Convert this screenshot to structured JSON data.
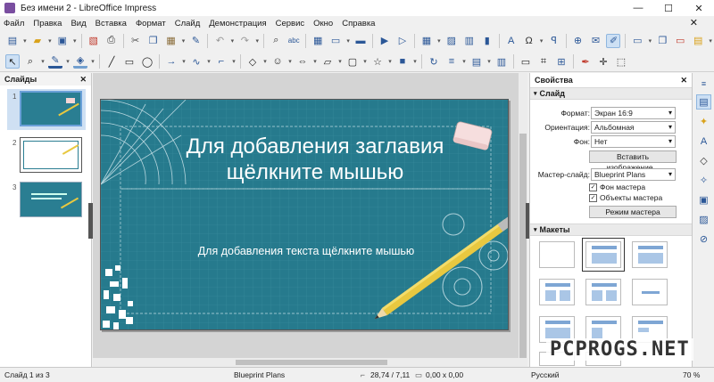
{
  "window": {
    "title": "Без имени 2 - LibreOffice Impress",
    "minimize": "—",
    "maximize": "☐",
    "close": "✕"
  },
  "menu": [
    "Файл",
    "Правка",
    "Вид",
    "Вставка",
    "Формат",
    "Слайд",
    "Демонстрация",
    "Сервис",
    "Окно",
    "Справка"
  ],
  "menu_close": "✕",
  "slides_panel": {
    "title": "Слайды",
    "close": "✕",
    "slides": [
      {
        "num": "1",
        "layout": "blue"
      },
      {
        "num": "2",
        "layout": "white"
      },
      {
        "num": "3",
        "layout": "blue"
      }
    ]
  },
  "slide": {
    "title": "Для добавления заглавия щёлкните мышью",
    "subtitle": "Для добавления текста щёлкните мышью",
    "background": "#267a8d"
  },
  "properties": {
    "title": "Свойства",
    "close": "✕",
    "slide_section": "Слайд",
    "format_label": "Формат:",
    "format_value": "Экран 16:9",
    "orientation_label": "Ориентация:",
    "orientation_value": "Альбомная",
    "background_label": "Фон:",
    "background_value": "Нет",
    "insert_image_button": "Вставить изображение...",
    "master_label": "Мастер-слайд:",
    "master_value": "Blueprint Plans",
    "master_bg_check": "Фон мастера",
    "master_objects_check": "Объекты мастера",
    "master_mode_button": "Режим мастера",
    "layouts_section": "Макеты"
  },
  "statusbar": {
    "slide_info": "Слайд 1 из 3",
    "master_name": "Blueprint Plans",
    "position": "28,74 / 7,11",
    "size": "0,00 x 0,00",
    "language": "Русский",
    "zoom": "70 %"
  },
  "watermark": "PCPROGS.NET",
  "colors": {
    "accent": "#2b5797",
    "slide_bg": "#267a8d"
  }
}
